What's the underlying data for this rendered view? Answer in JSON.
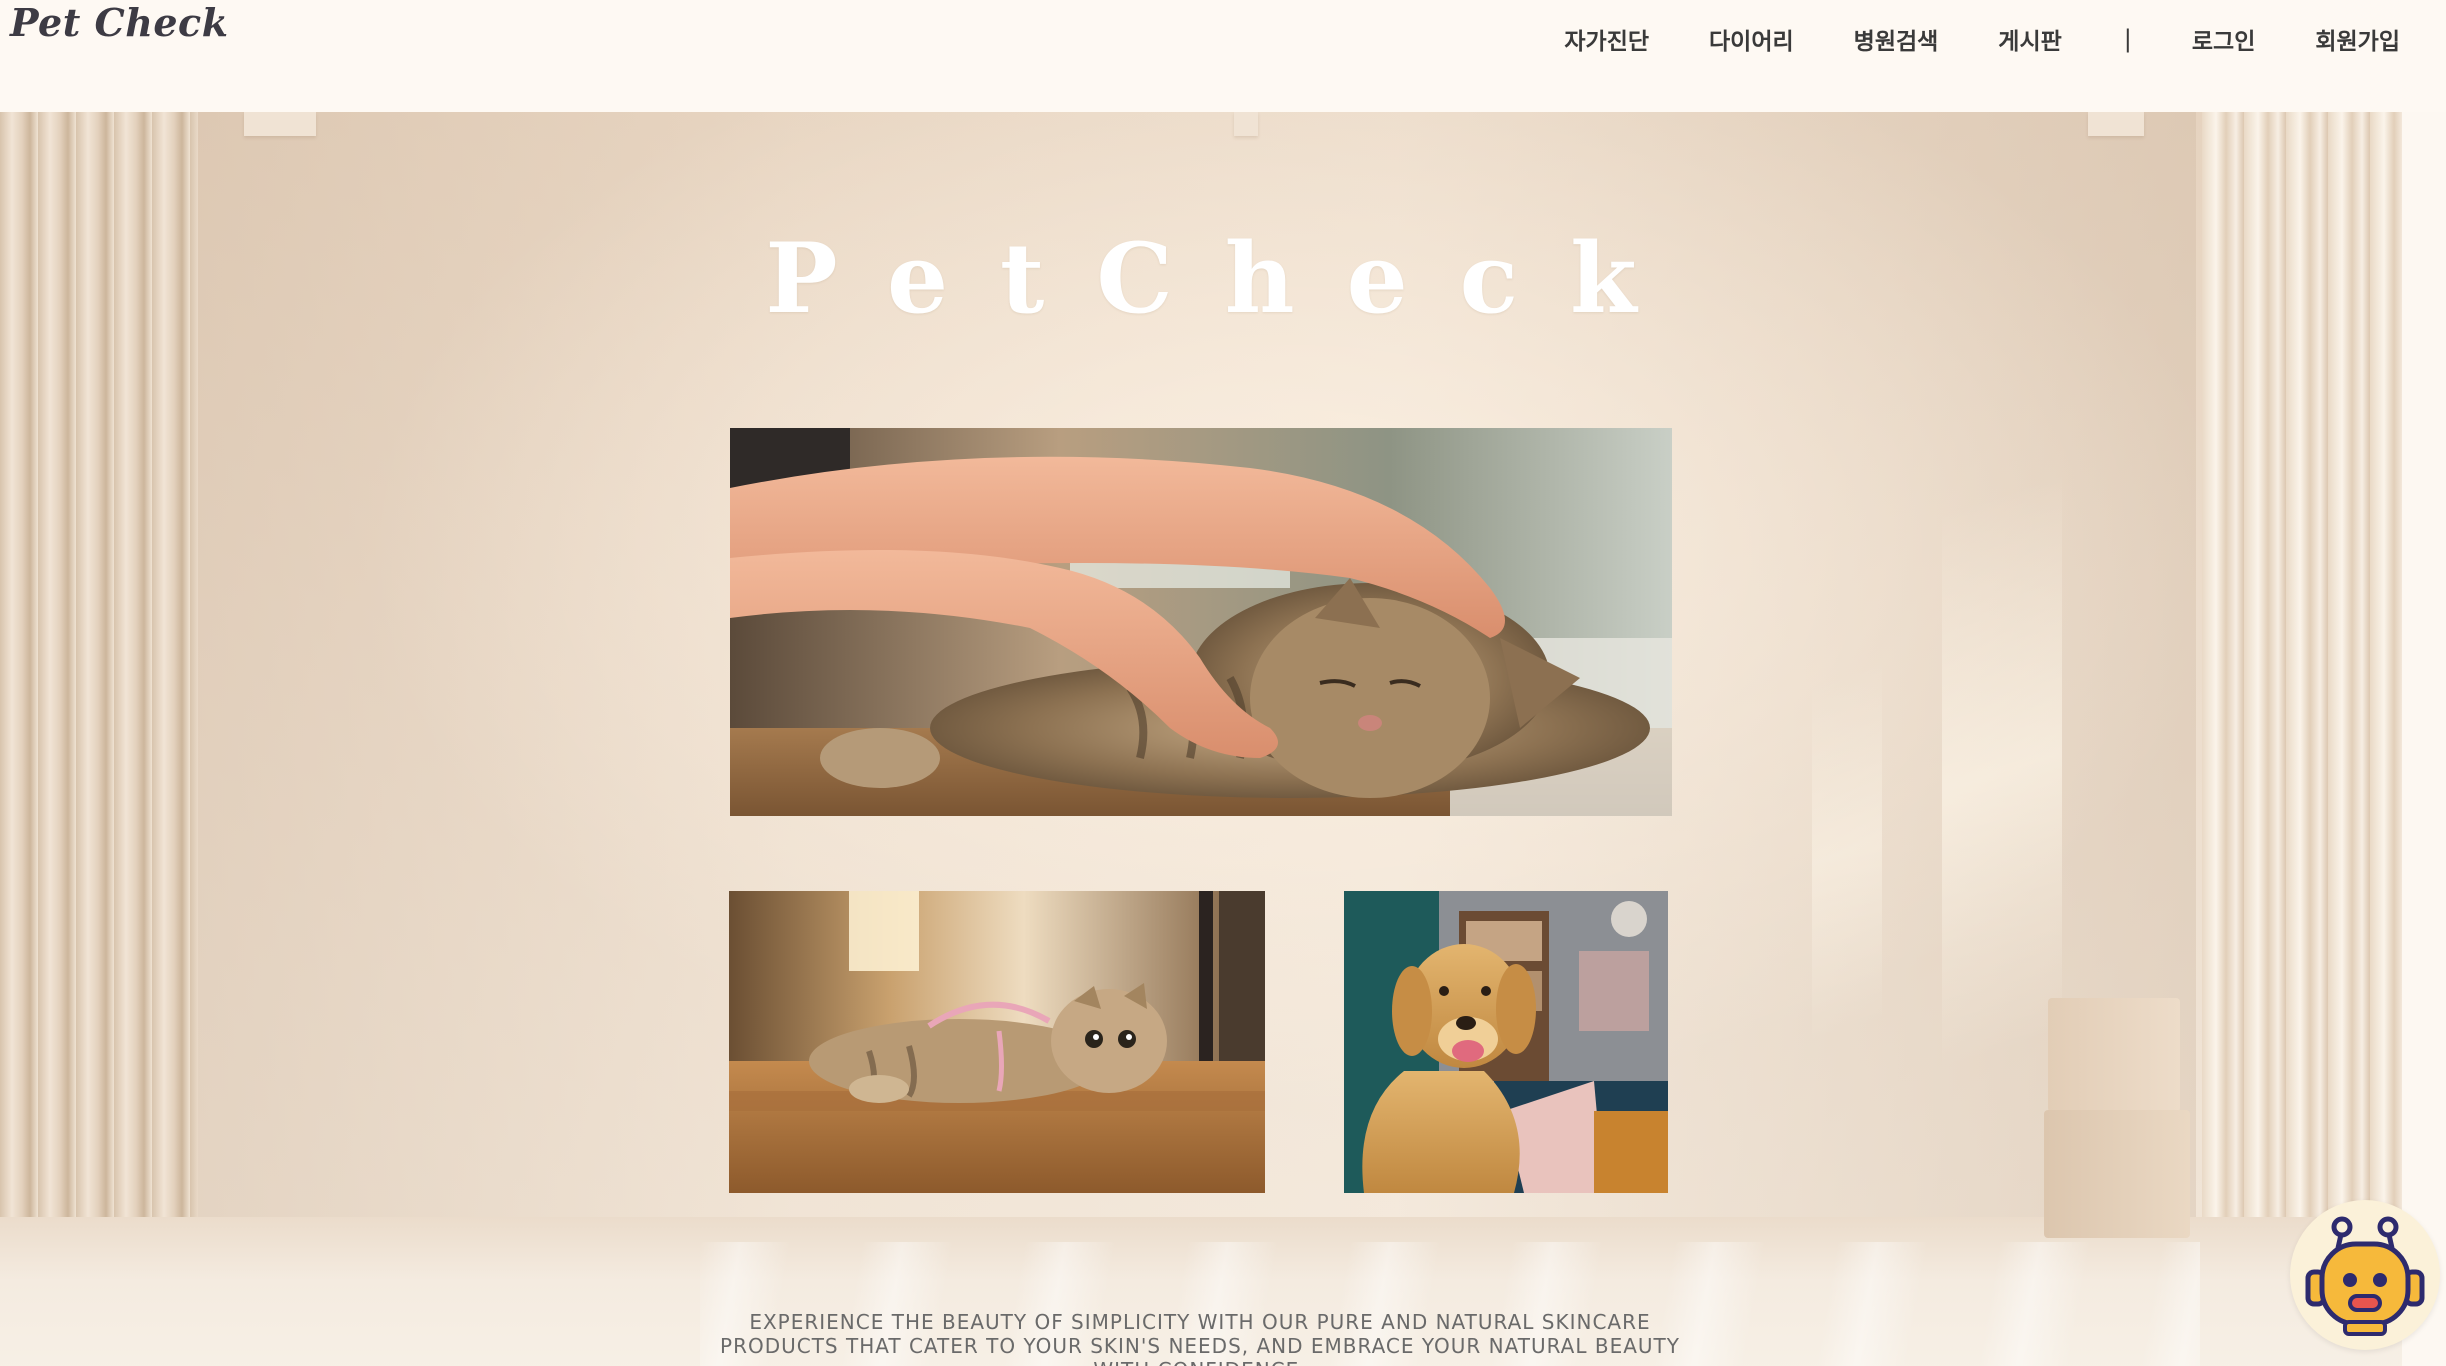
{
  "header": {
    "logo": "Pet Check",
    "nav": {
      "self_diagnosis": "자가진단",
      "diary": "다이어리",
      "hospital_search": "병원검색",
      "board": "게시판",
      "separator": "|",
      "login": "로그인",
      "signup": "회원가입"
    }
  },
  "hero": {
    "title": "PetCheck",
    "tagline": "EXPERIENCE THE BEAUTY OF SIMPLICITY WITH OUR PURE AND NATURAL SKINCARE PRODUCTS THAT CATER TO YOUR SKIN'S NEEDS, AND EMBRACE YOUR NATURAL BEAUTY WITH CONFIDENCE."
  },
  "photos": {
    "main": "hand-petting-cat-photo",
    "second": "scottish-fold-cat-photo",
    "third": "golden-retriever-photo"
  },
  "chatbot": {
    "icon": "robot-chatbot-icon"
  },
  "colors": {
    "header_bg": "#fef9f3",
    "nav_text": "#3a3a3a",
    "title": "#ffffff",
    "chatbot_bg": "#fbf1d9",
    "chatbot_robot": "#f6b93b"
  }
}
